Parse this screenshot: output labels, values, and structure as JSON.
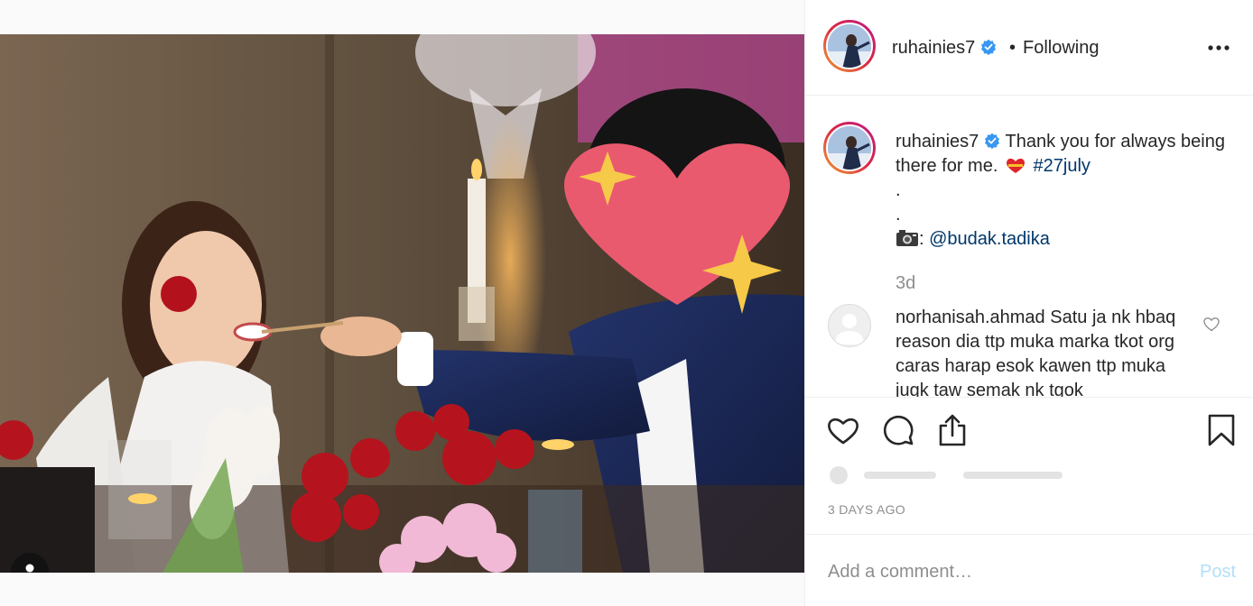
{
  "post": {
    "username": "ruhainies7",
    "separator": "•",
    "follow_status": "Following",
    "more_label": "•••"
  },
  "caption": {
    "username": "ruhainies7",
    "text_1": "Thank you for always being there for me.",
    "hashtag": "#27july",
    "line_dot_1": ".",
    "line_dot_2": ".",
    "photo_credit_sep": ":",
    "photo_credit": "@budak.tadika",
    "time": "3d"
  },
  "comment": {
    "username": "norhanisah.ahmad",
    "text": "Satu ja nk hbaq reason dia ttp muka marka tkot org caras harap esok kawen ttp muka jugk taw semak nk tgok"
  },
  "timestamp": "3 DAYS AGO",
  "add_comment": {
    "placeholder": "Add a comment…",
    "post_label": "Post"
  },
  "colors": {
    "verified": "#3897f0",
    "link": "#00376b",
    "post_disabled": "#b2dffc",
    "muted": "#8e8e8e"
  },
  "icons": [
    "verified-badge-icon",
    "more-options-icon",
    "like-heart-icon",
    "comment-bubble-icon",
    "share-icon",
    "save-bookmark-icon",
    "comment-like-heart-icon",
    "tag-user-icon"
  ]
}
